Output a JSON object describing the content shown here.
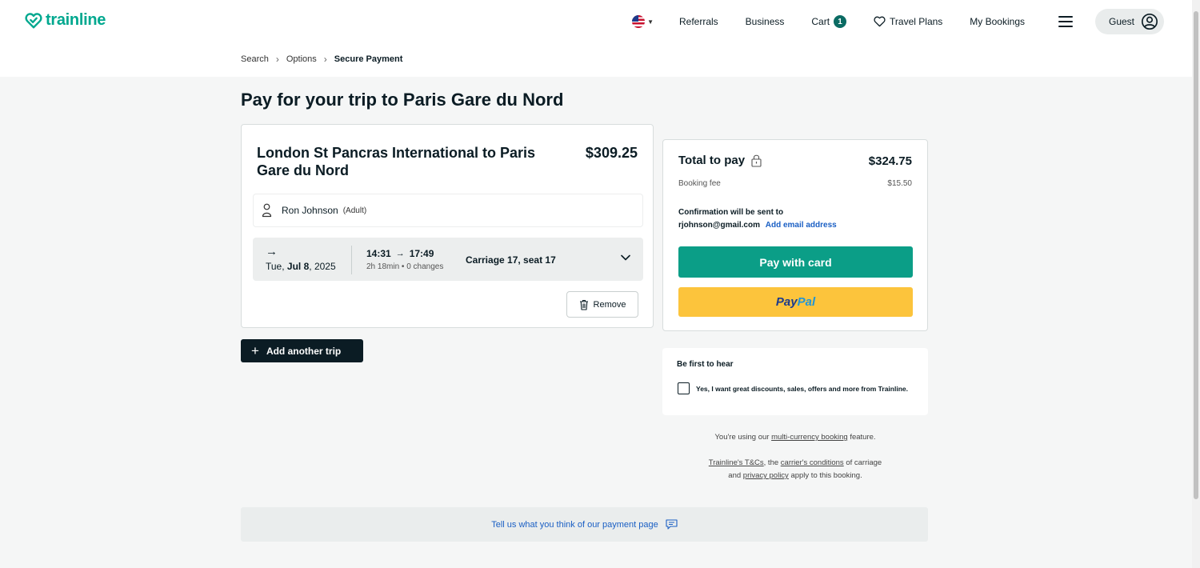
{
  "header": {
    "logo_text": "trainline",
    "nav": {
      "referrals": "Referrals",
      "business": "Business",
      "cart": "Cart",
      "cart_count": "1",
      "travel_plans": "Travel Plans",
      "my_bookings": "My Bookings",
      "guest": "Guest"
    }
  },
  "breadcrumb": {
    "items": [
      "Search",
      "Options",
      "Secure Payment"
    ]
  },
  "page_title": "Pay for your trip to Paris Gare du Nord",
  "trip": {
    "route": "London St Pancras International to Paris Gare du Nord",
    "price": "$309.25",
    "passenger_name": "Ron Johnson",
    "passenger_type": "(Adult)",
    "arrow": "→",
    "date_day": "Tue,",
    "date_month_day": "Jul 8",
    "date_year": ", 2025",
    "depart": "14:31",
    "arrive": "17:49",
    "duration": "2h 18min • 0 changes",
    "seat": "Carriage 17, seat 17",
    "remove_label": "Remove"
  },
  "add_trip_label": "Add another trip",
  "payment": {
    "total_label": "Total to pay",
    "total_value": "$324.75",
    "fee_label": "Booking fee",
    "fee_value": "$15.50",
    "confirm_text": "Confirmation will be sent to",
    "email": "rjohnson@gmail.com",
    "add_email": "Add email address",
    "pay_card_label": "Pay with card",
    "paypal_part1": "Pay",
    "paypal_part2": "Pal"
  },
  "marketing": {
    "title": "Be first to hear",
    "checkbox_label": "Yes, I want great discounts, sales, offers and more from Trainline.",
    "checked": false
  },
  "notes": {
    "multi_prefix": "You're using our ",
    "multi_link": "multi-currency booking",
    "multi_suffix": " feature.",
    "tc_link": "Trainline's T&Cs",
    "tc_mid": ", the ",
    "carrier_link": "carrier's conditions",
    "tc_mid2": " of carriage",
    "and_text": "and ",
    "privacy_link": "privacy policy",
    "privacy_suffix": " apply to this booking."
  },
  "feedback_label": "Tell us what you think of our payment page",
  "colors": {
    "brand": "#00a88f",
    "pay_button": "#0b9e87",
    "paypal_button": "#fcc43c",
    "link": "#1a5fc4"
  }
}
